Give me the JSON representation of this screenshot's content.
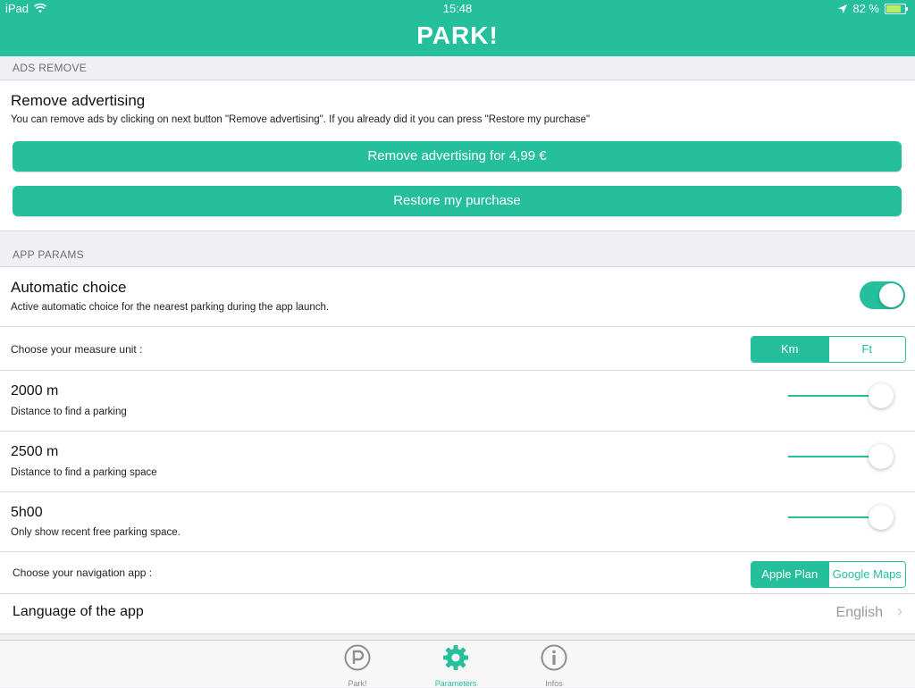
{
  "status_bar": {
    "device": "iPad",
    "time": "15:48",
    "battery": "82 %",
    "battery_level": 0.82
  },
  "header": {
    "title": "PARK!"
  },
  "ads_section": {
    "header": "ADS REMOVE",
    "title": "Remove advertising",
    "description": "You can remove ads by clicking on next button \"Remove advertising\". If you already did it you can press \"Restore my purchase\"",
    "remove_button": "Remove advertising for 4,99 €",
    "restore_button": "Restore my purchase"
  },
  "app_params": {
    "header": "APP PARAMS",
    "automatic_choice": {
      "title": "Automatic choice",
      "description": "Active automatic choice for the nearest parking during the app launch.",
      "enabled": true
    },
    "measure_unit": {
      "label": "Choose your measure unit :",
      "options": [
        "Km",
        "Ft"
      ],
      "selected": "Km"
    },
    "distance_parking": {
      "value": "2000 m",
      "description": "Distance to find a parking",
      "level": 0.88
    },
    "distance_space": {
      "value": "2500 m",
      "description": "Distance to find a parking space",
      "level": 0.88
    },
    "recent_time": {
      "value": "5h00",
      "description": "Only show recent free parking space.",
      "level": 0.88
    },
    "navigation_app": {
      "label": "Choose your navigation app :",
      "options": [
        "Apple Plan",
        "Google Maps"
      ],
      "selected": "Apple Plan"
    },
    "language": {
      "label": "Language of the app",
      "value": "English"
    }
  },
  "tabbar": {
    "tabs": [
      {
        "label": "Park!",
        "icon": "parking-icon",
        "active": false
      },
      {
        "label": "Parameters",
        "icon": "gear-icon",
        "active": true
      },
      {
        "label": "Infos",
        "icon": "info-icon",
        "active": false
      }
    ]
  },
  "colors": {
    "accent": "#26bf9c",
    "background": "#efeff4"
  }
}
